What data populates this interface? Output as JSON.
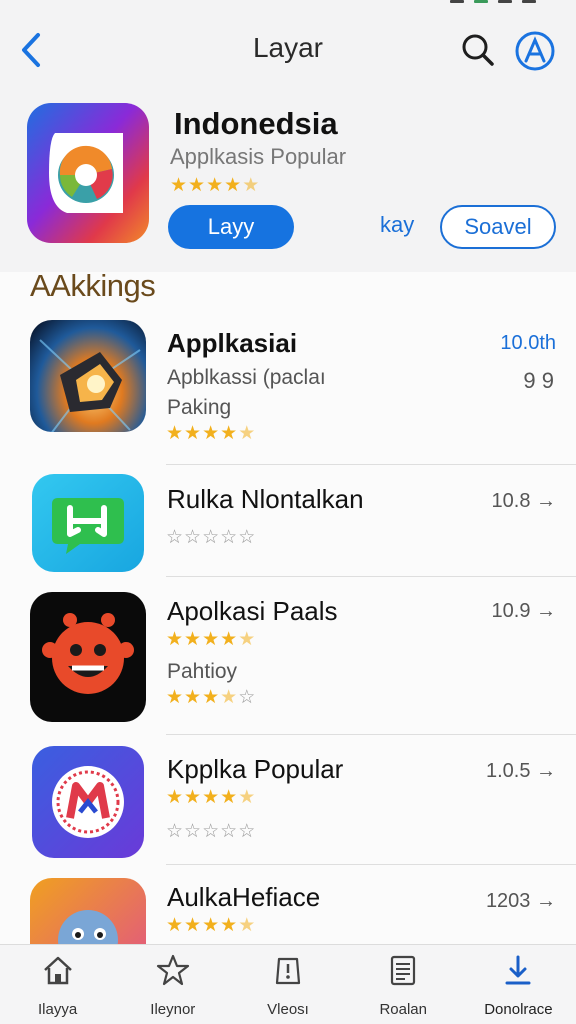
{
  "header": {
    "title": "Layar",
    "back_icon": "chevron-left-icon",
    "search_icon": "search-icon",
    "profile_icon": "account-icon",
    "accent": "#1673e0"
  },
  "featured": {
    "name": "Indonedsia",
    "subtitle": "Applkasis Popular",
    "rating": 4.5,
    "primary_button": "Layy",
    "link_text": "kay",
    "secondary_button": "Soavel"
  },
  "section": {
    "title": "AAkkings"
  },
  "apps": [
    {
      "name": "Applkasiai",
      "line1": "Apblkassi (paclaı",
      "line2": "Paking",
      "meta": "10.0th",
      "meta2": "9 9",
      "rating": 4.5
    },
    {
      "name": "Rulka Nlontalkan",
      "meta": "10.8 →",
      "rating": 0
    },
    {
      "name": "Apolkasi Paals",
      "line2": "Pahtioy",
      "meta": "10.9 →",
      "rating": 4.5,
      "rating2": 3.5
    },
    {
      "name": "Kpplka Popular",
      "meta": "1.0.5 →",
      "rating": 4.5,
      "rating2": 0
    },
    {
      "name": "AulkaHefiace",
      "meta": "1203 →",
      "rating": 4.5
    }
  ],
  "tabs": [
    {
      "label": "Ilayya",
      "icon": "home-icon"
    },
    {
      "label": "Ileynor",
      "icon": "star-icon"
    },
    {
      "label": "Vleosı",
      "icon": "alert-icon"
    },
    {
      "label": "Roalan",
      "icon": "document-icon"
    },
    {
      "label": "Donolrace",
      "icon": "download-icon"
    }
  ]
}
